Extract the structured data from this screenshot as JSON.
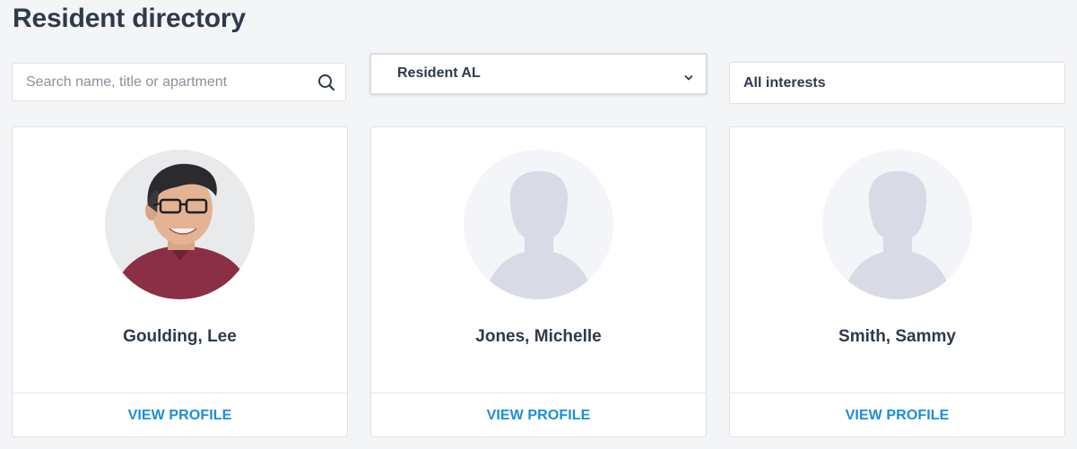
{
  "page": {
    "title": "Resident directory"
  },
  "filters": {
    "search_placeholder": "Search name, title or apartment",
    "search_value": "",
    "role_selected": "Resident AL",
    "interests_selected": "All interests"
  },
  "residents": [
    {
      "name": "Goulding, Lee",
      "avatar": "photo",
      "action_label": "VIEW PROFILE"
    },
    {
      "name": "Jones, Michelle",
      "avatar": "placeholder-silhouette",
      "action_label": "VIEW PROFILE"
    },
    {
      "name": "Smith, Sammy",
      "avatar": "placeholder-silhouette",
      "action_label": "VIEW PROFILE"
    }
  ],
  "colors": {
    "background": "#f4f5f7",
    "text": "#2f3a4b",
    "link": "#1a8fd8",
    "placeholder_silhouette": "#d8dbe6"
  }
}
